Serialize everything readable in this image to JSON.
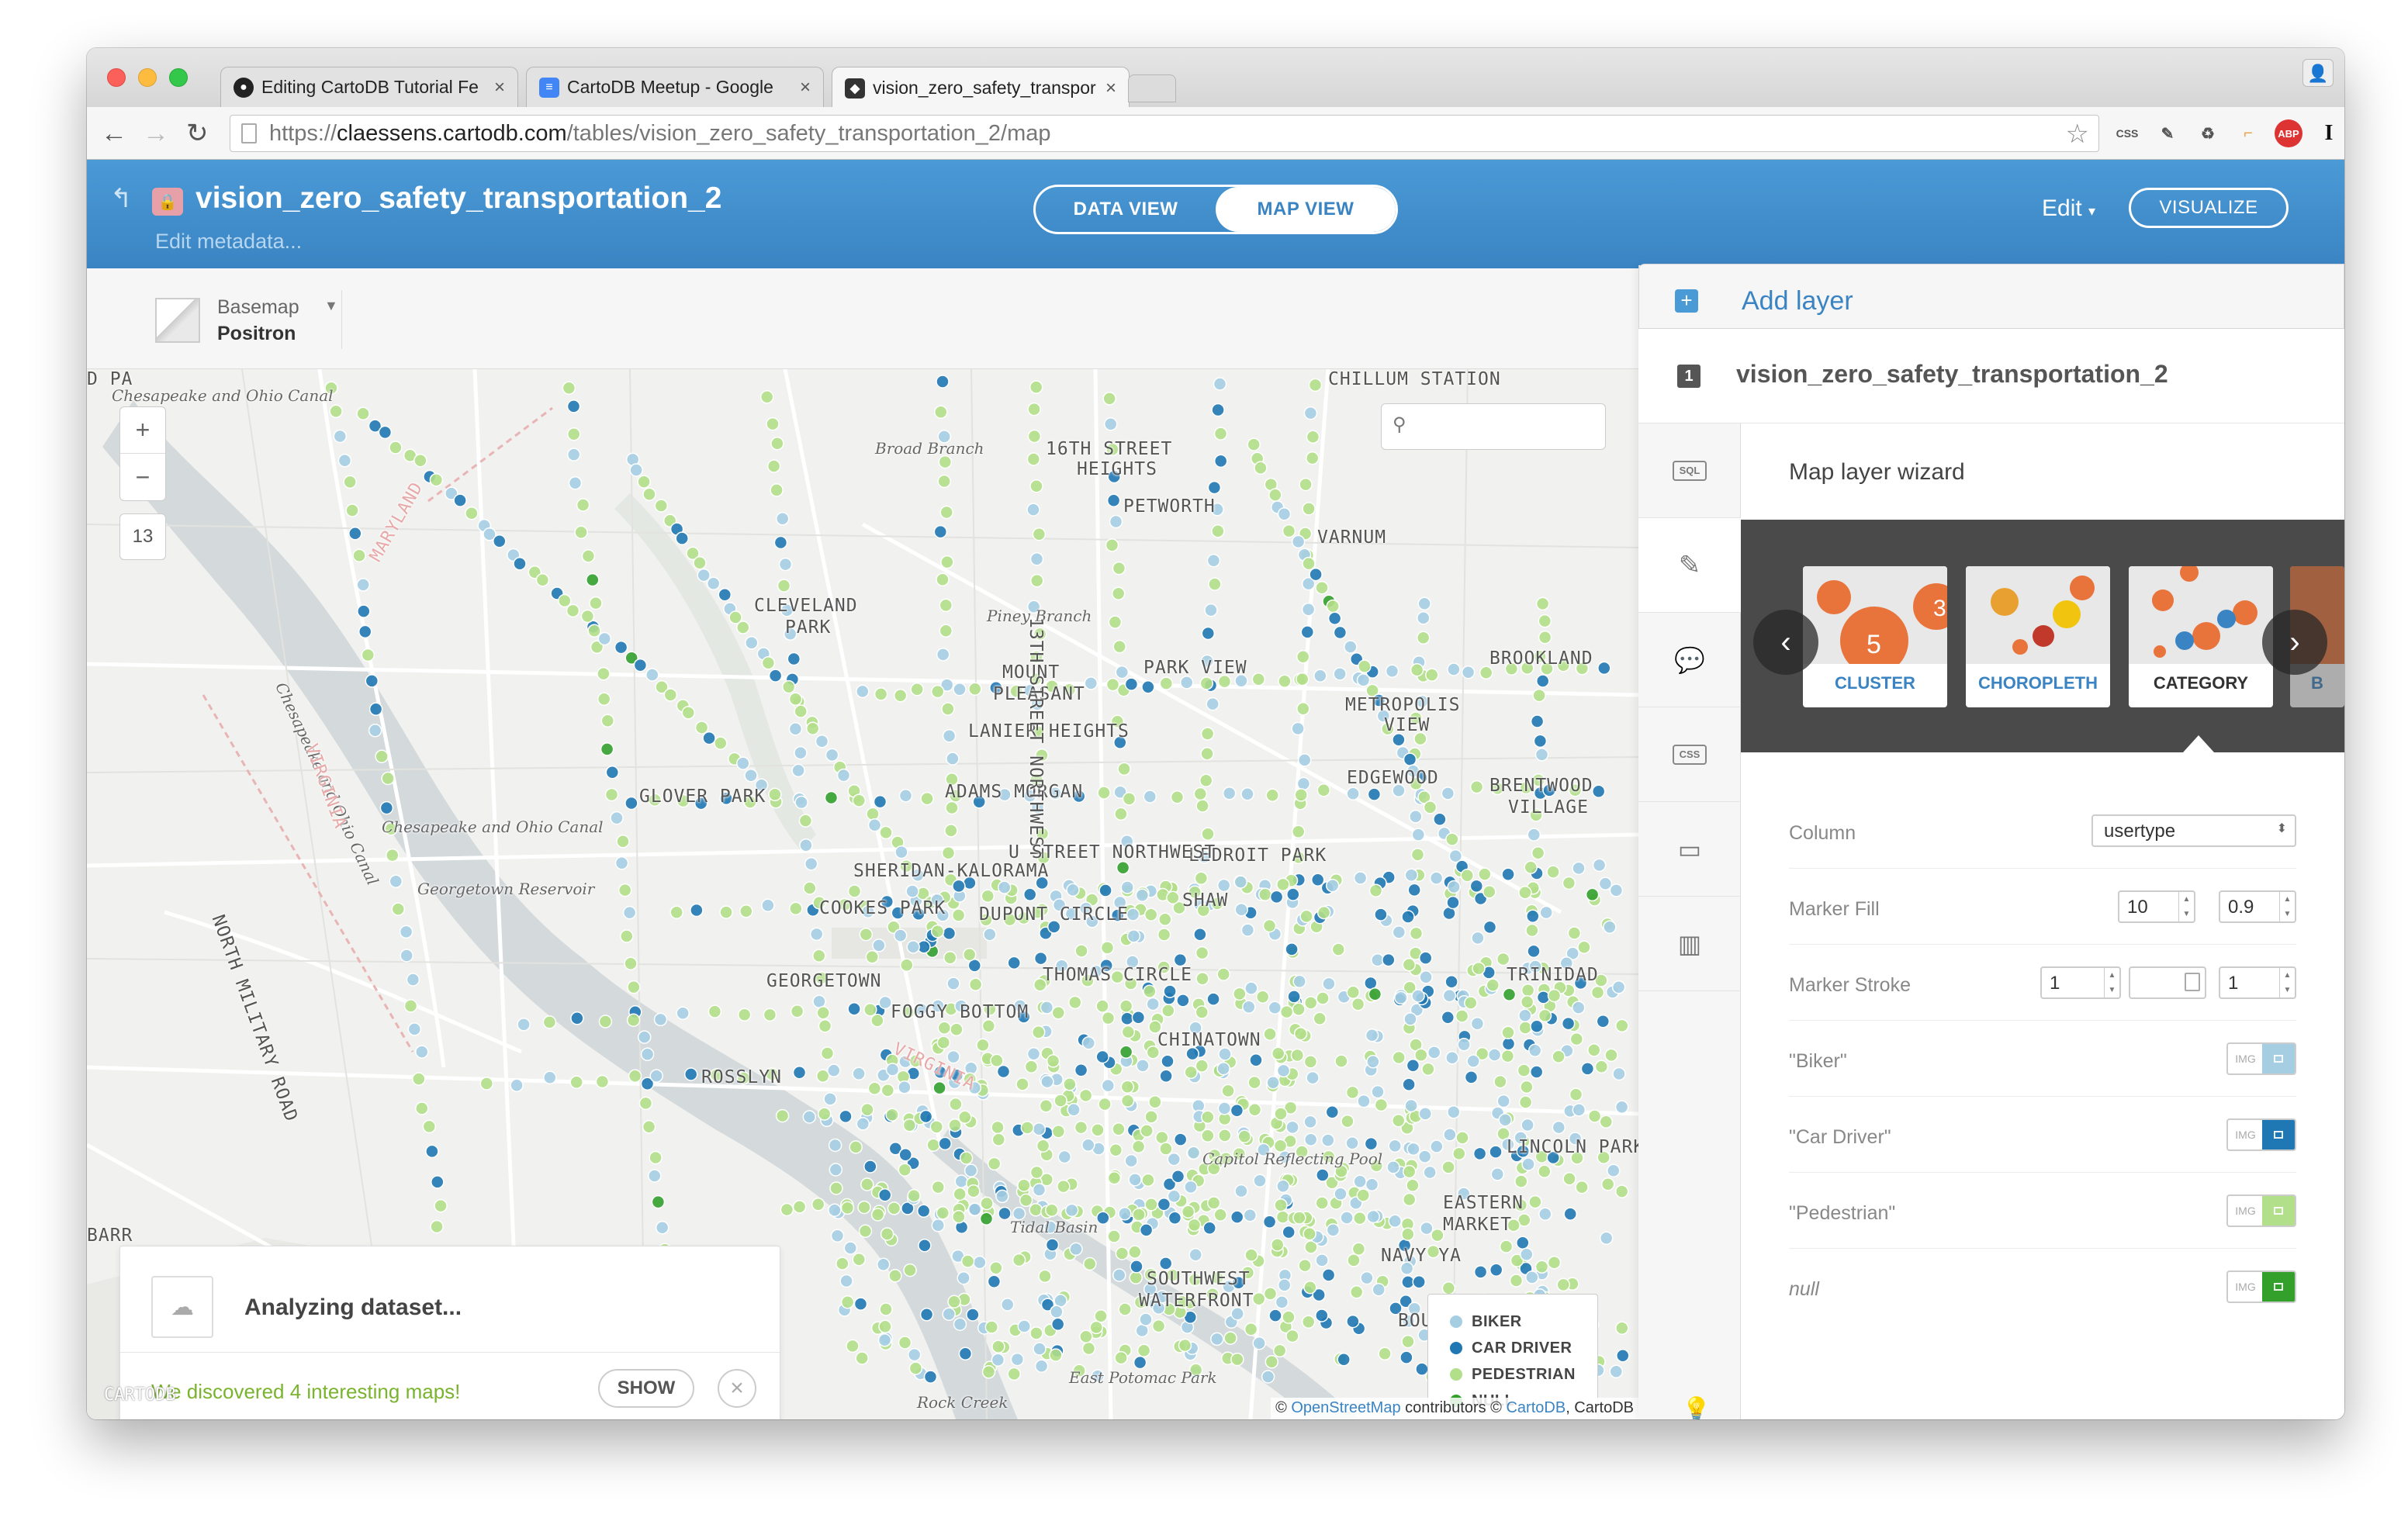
{
  "browser": {
    "tabs": [
      {
        "title": "Editing CartoDB Tutorial Fe",
        "favicon": "github-icon",
        "color": "#222222"
      },
      {
        "title": "CartoDB Meetup - Google",
        "favicon": "google-docs-icon",
        "color": "#4285f4"
      },
      {
        "title": "vision_zero_safety_transpor",
        "favicon": "cartodb-icon",
        "color": "#333333"
      }
    ],
    "url_scheme": "https://",
    "url_host": "claessens.cartodb.com",
    "url_path": "/tables/vision_zero_safety_transportation_2/map",
    "extensions": [
      "CSS",
      "ABP",
      "I"
    ]
  },
  "header": {
    "table_name": "vision_zero_safety_transportation_2",
    "edit_metadata": "Edit metadata...",
    "data_view": "DATA VIEW",
    "map_view": "MAP VIEW",
    "edit": "Edit",
    "visualize": "VISUALIZE"
  },
  "basemap": {
    "label": "Basemap",
    "value": "Positron"
  },
  "map": {
    "zoom_in": "+",
    "zoom_out": "−",
    "zoom_level": "13",
    "labels": [
      {
        "text": "CHILLUM STATION",
        "style": ""
      },
      {
        "text": "Chesapeake and Ohio Canal",
        "style": "italic"
      },
      {
        "text": "Broad Branch",
        "style": "italic"
      },
      {
        "text": "16TH STREET",
        "style": ""
      },
      {
        "text": "HEIGHTS",
        "style": ""
      },
      {
        "text": "PETWORTH",
        "style": ""
      },
      {
        "text": "VARNUM",
        "style": ""
      },
      {
        "text": "MARYLAND",
        "style": "state"
      },
      {
        "text": "CLEVELAND",
        "style": ""
      },
      {
        "text": "PARK",
        "style": ""
      },
      {
        "text": "Piney Branch",
        "style": "italic"
      },
      {
        "text": "PARK VIEW",
        "style": ""
      },
      {
        "text": "BROOKLAND",
        "style": ""
      },
      {
        "text": "MOUNT",
        "style": ""
      },
      {
        "text": "PLEASANT",
        "style": ""
      },
      {
        "text": "METROPOLIS",
        "style": ""
      },
      {
        "text": "VIEW",
        "style": ""
      },
      {
        "text": "LANIER HEIGHTS",
        "style": ""
      },
      {
        "text": "EDGEWOOD",
        "style": ""
      },
      {
        "text": "BRENTWOOD",
        "style": ""
      },
      {
        "text": "VILLAGE",
        "style": ""
      },
      {
        "text": "GLOVER PARK",
        "style": ""
      },
      {
        "text": "ADAMS MORGAN",
        "style": ""
      },
      {
        "text": "Chesapeake and Ohio Canal",
        "style": "italic"
      },
      {
        "text": "LEDROIT PARK",
        "style": ""
      },
      {
        "text": "SHERIDAN-KALORAMA",
        "style": ""
      },
      {
        "text": "Georgetown Reservoir",
        "style": "italic"
      },
      {
        "text": "COOKES PARK",
        "style": ""
      },
      {
        "text": "DUPONT CIRCLE",
        "style": ""
      },
      {
        "text": "SHAW",
        "style": ""
      },
      {
        "text": "GEORGETOWN",
        "style": ""
      },
      {
        "text": "THOMAS CIRCLE",
        "style": ""
      },
      {
        "text": "TRINIDAD",
        "style": ""
      },
      {
        "text": "FOGGY BOTTOM",
        "style": ""
      },
      {
        "text": "CHINATOWN",
        "style": ""
      },
      {
        "text": "ROSSLYN",
        "style": ""
      },
      {
        "text": "VIRGINIA",
        "style": "state"
      },
      {
        "text": "LINCOLN PARK",
        "style": ""
      },
      {
        "text": "Capitol Reflecting Pool",
        "style": "italic"
      },
      {
        "text": "EASTERN",
        "style": ""
      },
      {
        "text": "MARKET",
        "style": ""
      },
      {
        "text": "Tidal Basin",
        "style": "italic"
      },
      {
        "text": "SOUTHWEST",
        "style": ""
      },
      {
        "text": "WATERFRONT",
        "style": ""
      },
      {
        "text": "East Potomac Park",
        "style": "italic"
      },
      {
        "text": "NORTH MILITARY ROAD",
        "style": ""
      },
      {
        "text": "Chesapeake and Ohio Canal",
        "style": "italic"
      },
      {
        "text": "VIRGINIA",
        "style": "state"
      },
      {
        "text": "13TH STREET NORTHWEST",
        "style": ""
      },
      {
        "text": "U STREET NORTHWEST",
        "style": ""
      },
      {
        "text": "Rock Creek",
        "style": "italic"
      },
      {
        "text": "BOULEVARD",
        "style": ""
      },
      {
        "text": "NAVY YA",
        "style": ""
      },
      {
        "text": "BARR",
        "style": ""
      },
      {
        "text": "D PA",
        "style": ""
      }
    ],
    "analyzing": {
      "title": "Analyzing dataset...",
      "found": "We discovered 4 interesting maps!",
      "show": "SHOW"
    },
    "legend": [
      {
        "label": "BIKER",
        "color": "#a6cee3"
      },
      {
        "label": "CAR DRIVER",
        "color": "#1f78b4"
      },
      {
        "label": "PEDESTRIAN",
        "color": "#b2df8a"
      },
      {
        "label": "NULL",
        "color": "#33a02c"
      }
    ],
    "attribution": {
      "prefix": "© ",
      "osm": "OpenStreetMap",
      "mid": " contributors © ",
      "cartodb": "CartoDB",
      "suffix": ", CartoDB"
    },
    "logo": "CARTODB"
  },
  "panel": {
    "add_layer": "Add layer",
    "layer_number": "1",
    "layer_name": "vision_zero_safety_transportation_2",
    "sidebar": [
      "SQL",
      "wizard",
      "infowindow",
      "CSS",
      "legend",
      "filters",
      "tips"
    ],
    "wizard_title": "Map layer wizard",
    "types": [
      {
        "name": "CLUSTER",
        "state": "normal"
      },
      {
        "name": "CHOROPLETH",
        "state": "normal"
      },
      {
        "name": "CATEGORY",
        "state": "selected"
      },
      {
        "name": "B",
        "state": "dim"
      }
    ],
    "cluster_numbers": [
      "5",
      "3"
    ],
    "properties": {
      "column_label": "Column",
      "column_value": "usertype",
      "fill_label": "Marker Fill",
      "fill_size": "10",
      "fill_opacity": "0.9",
      "stroke_label": "Marker Stroke",
      "stroke_width": "1",
      "stroke_opacity": "1"
    },
    "categories": [
      {
        "label": "\"Biker\"",
        "color": "#a6cee3",
        "italic": false
      },
      {
        "label": "\"Car Driver\"",
        "color": "#1f78b4",
        "italic": false
      },
      {
        "label": "\"Pedestrian\"",
        "color": "#b2df8a",
        "italic": false
      },
      {
        "label": "null",
        "color": "#33a02c",
        "italic": true
      }
    ],
    "img_label": "IMG"
  }
}
